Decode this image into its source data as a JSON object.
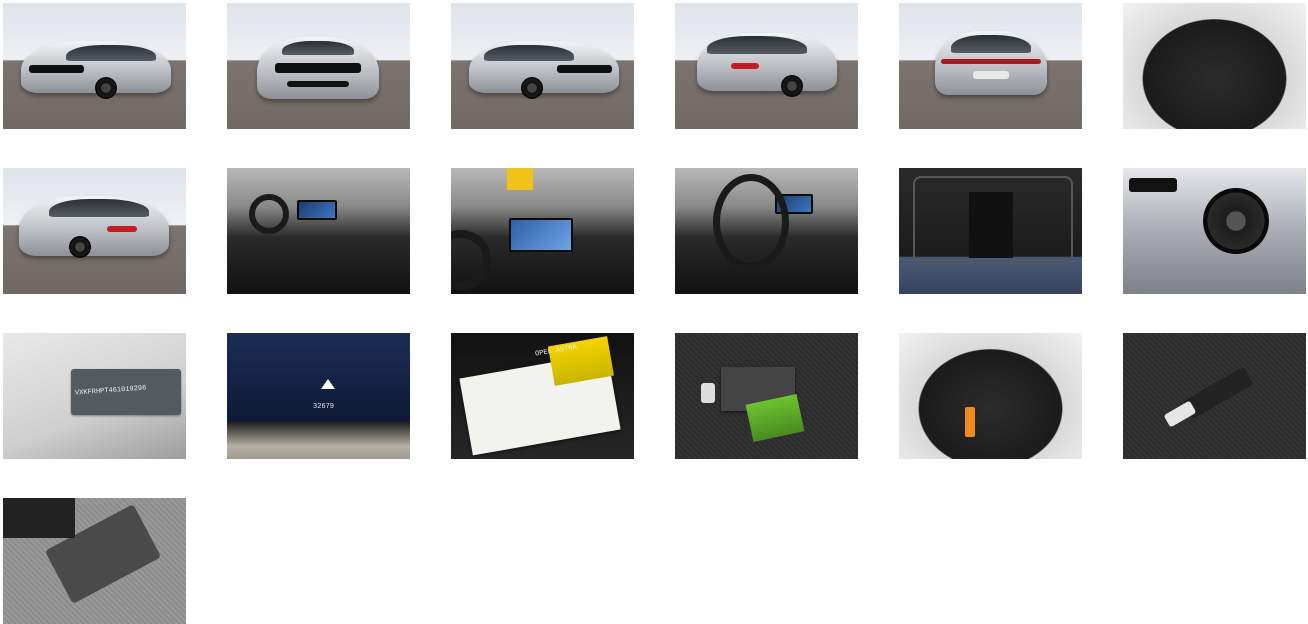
{
  "gallery": {
    "images": [
      {
        "id": "front-three-quarter-left",
        "text": ""
      },
      {
        "id": "front",
        "text": ""
      },
      {
        "id": "front-three-quarter-right",
        "text": ""
      },
      {
        "id": "rear-three-quarter-left",
        "text": ""
      },
      {
        "id": "rear",
        "text": ""
      },
      {
        "id": "trunk-open",
        "text": ""
      },
      {
        "id": "rear-three-quarter-right",
        "text": ""
      },
      {
        "id": "cabin-overview",
        "text": ""
      },
      {
        "id": "center-display",
        "text": ""
      },
      {
        "id": "steering-wheel",
        "text": ""
      },
      {
        "id": "rear-seats",
        "text": ""
      },
      {
        "id": "wheel-detail",
        "text": ""
      },
      {
        "id": "vin-plate",
        "text": "VXKFRHPT461019296"
      },
      {
        "id": "odometer-display",
        "text": "32679"
      },
      {
        "id": "owner-manual",
        "text": "OPEL ASTRA"
      },
      {
        "id": "keys-and-documents",
        "text": ""
      },
      {
        "id": "trunk-underfloor",
        "text": ""
      },
      {
        "id": "cargo-net",
        "text": ""
      },
      {
        "id": "storage-compartment",
        "text": ""
      }
    ]
  }
}
